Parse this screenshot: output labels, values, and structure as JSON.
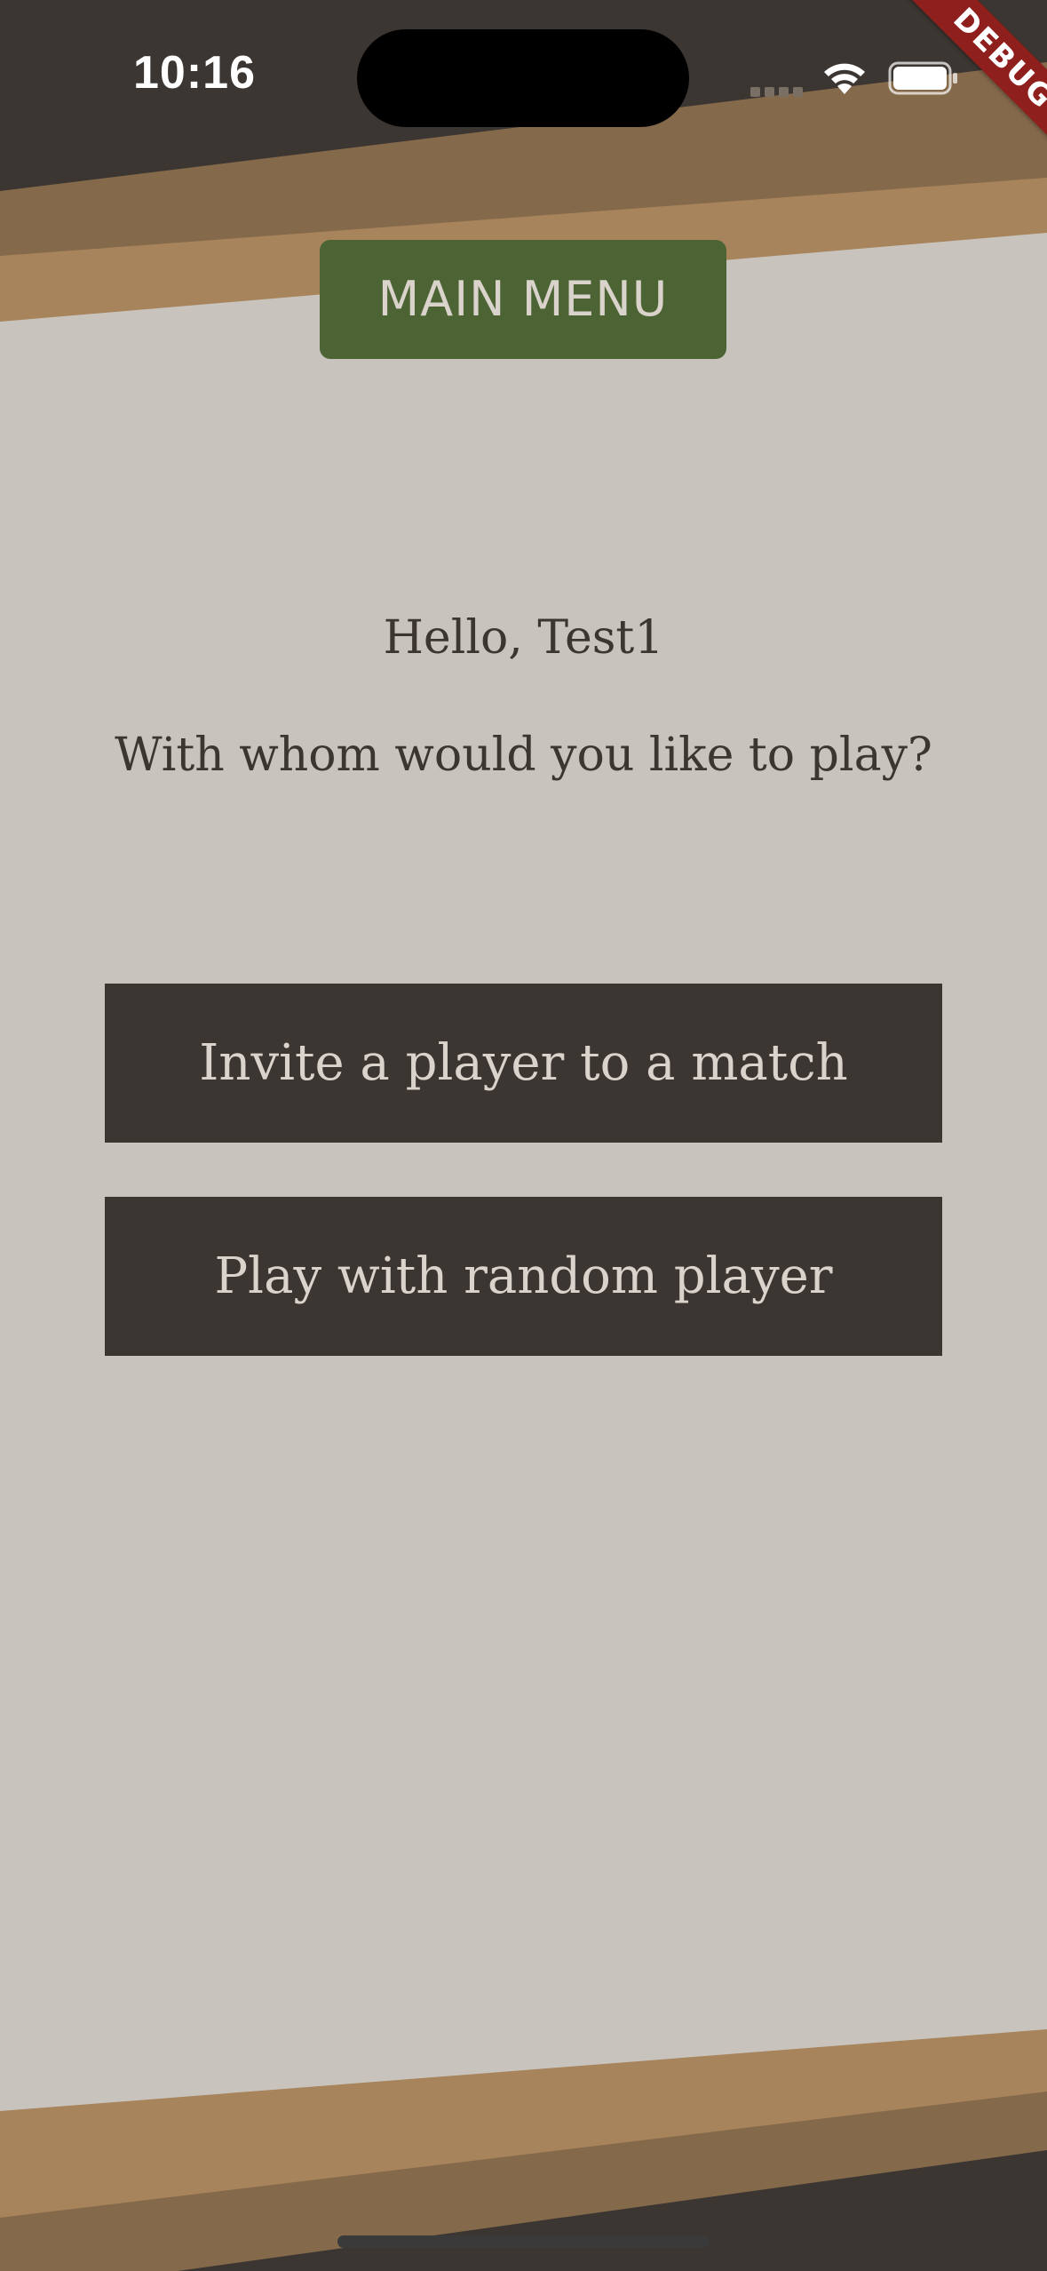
{
  "status_bar": {
    "time": "10:16"
  },
  "debug_banner": {
    "label": "DEBUG"
  },
  "header": {
    "main_menu_label": "MAIN MENU"
  },
  "main": {
    "greeting": "Hello, Test1",
    "question": "With whom would you like to play?",
    "invite_button_label": "Invite a player to a match",
    "random_button_label": "Play with random player"
  },
  "colors": {
    "background": "#c8c3bd",
    "dark_brown": "#3c3632",
    "mid_brown": "#85694b",
    "tan": "#a7845b",
    "menu_green": "#4c6433",
    "button_text": "#d9d3cc",
    "debug_red": "#8f1f1c"
  },
  "icons": {
    "signal": "cell-signal-icon",
    "wifi": "wifi-icon",
    "battery": "battery-icon"
  }
}
